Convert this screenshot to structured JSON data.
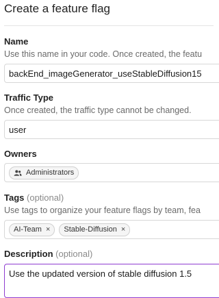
{
  "page": {
    "title": "Create a feature flag"
  },
  "name": {
    "label": "Name",
    "help": "Use this name in your code. Once created, the featu",
    "value": "backEnd_imageGenerator_useStableDiffusion15"
  },
  "traffic_type": {
    "label": "Traffic Type",
    "help": "Once created, the traffic type cannot be changed.",
    "value": "user"
  },
  "owners": {
    "label": "Owners",
    "items": [
      {
        "label": "Administrators",
        "icon": "group-icon"
      }
    ]
  },
  "tags": {
    "label": "Tags",
    "optional": "(optional)",
    "help": "Use tags to organize your feature flags by team, fea",
    "items": [
      {
        "label": "AI-Team"
      },
      {
        "label": "Stable-Diffusion"
      }
    ],
    "remove_glyph": "×"
  },
  "description": {
    "label": "Description",
    "optional": "(optional)",
    "value": "Use the updated version of stable diffusion 1.5",
    "focus_color": "#8e3bd0"
  }
}
